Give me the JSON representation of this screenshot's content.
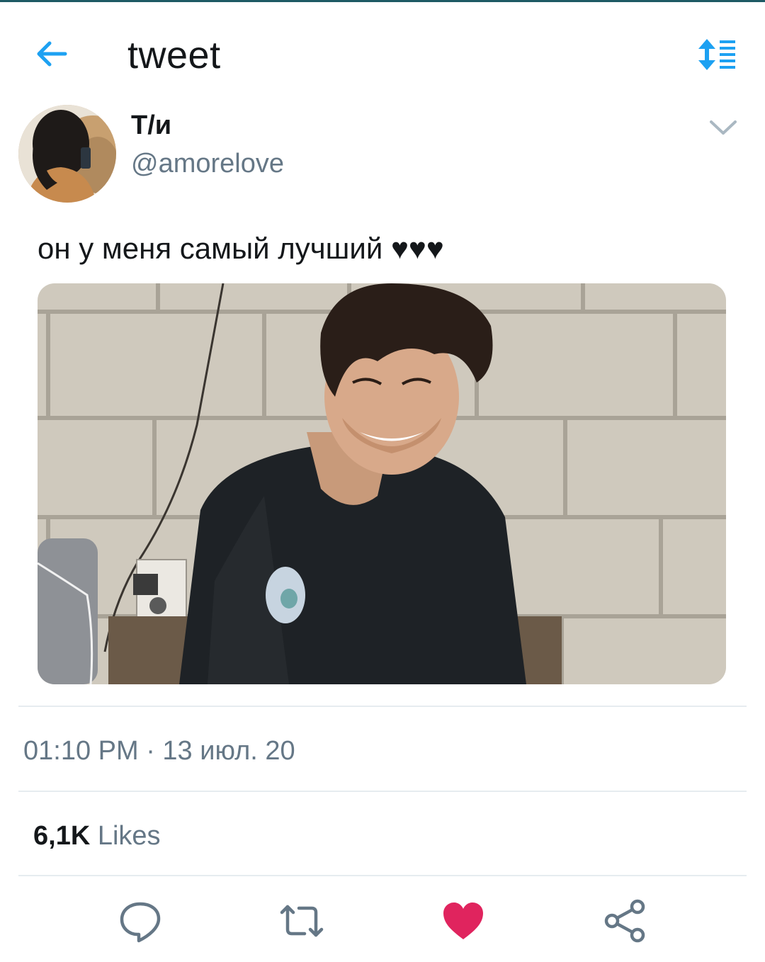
{
  "header": {
    "title": "tweet",
    "back_icon": "arrow-left-icon",
    "sort_icon": "sort-list-icon",
    "accent": "#1da1f2"
  },
  "author": {
    "display_name": "Т/и",
    "handle": "@amorelove",
    "avatar_icon": "avatar"
  },
  "tweet": {
    "text": "он у меня самый лучший ♥♥♥",
    "timestamp": "01:10 PM · 13 июл. 20"
  },
  "stats": {
    "likes_count": "6,1K",
    "likes_label": "Likes"
  },
  "actions": {
    "reply_icon": "reply-icon",
    "retweet_icon": "retweet-icon",
    "like_icon": "heart-icon",
    "share_icon": "share-icon",
    "like_color": "#e0245e",
    "icon_color": "#657786"
  }
}
